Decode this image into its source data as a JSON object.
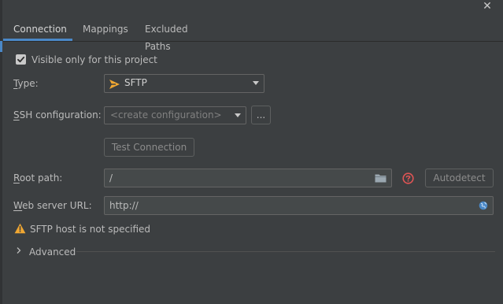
{
  "window": {
    "close_glyph": "✕"
  },
  "tabs": [
    {
      "label": "Connection",
      "active": true
    },
    {
      "label": "Mappings",
      "active": false
    },
    {
      "label": "Excluded Paths",
      "active": false
    }
  ],
  "visible_only": {
    "label": "Visible only for this project",
    "checked": true
  },
  "type": {
    "label_pre": "T",
    "label_post": "ype:",
    "value": "SFTP",
    "icon": "sftp-icon"
  },
  "ssh": {
    "label_pre": "S",
    "label_post": "SH configuration:",
    "placeholder": "<create configuration>",
    "more_label": "..."
  },
  "test_button": {
    "label": "Test Connection"
  },
  "root_path": {
    "label_pre": "R",
    "label_post": "oot path:",
    "value": "/",
    "autodetect_label": "Autodetect"
  },
  "web_url": {
    "label_pre": "W",
    "label_post": "eb server URL:",
    "value": "http://"
  },
  "warning": {
    "text": "SFTP host is not specified"
  },
  "advanced": {
    "label": "Advanced"
  },
  "colors": {
    "accent": "#4a88c7",
    "warning": "#f0a732",
    "error": "#e05555",
    "sftp": "#f0a732"
  }
}
